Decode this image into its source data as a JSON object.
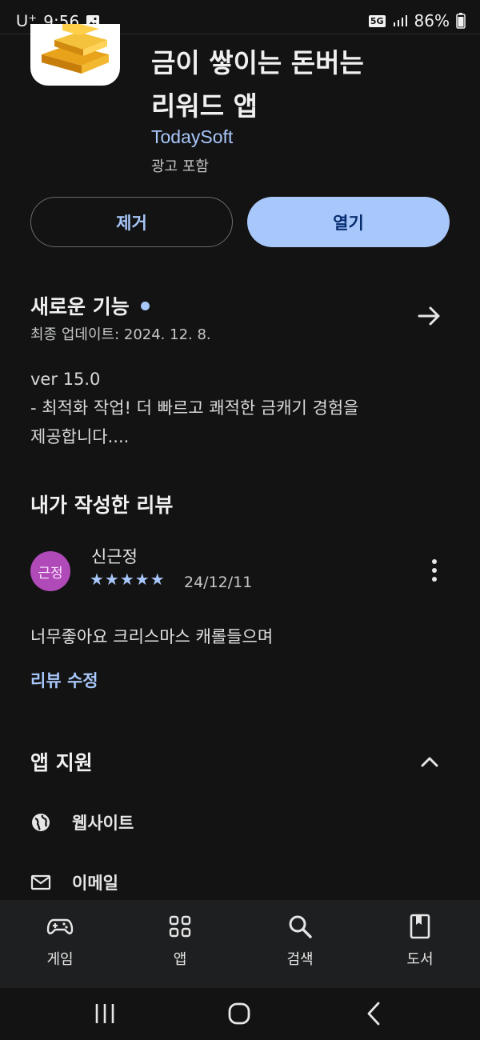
{
  "status_bar": {
    "carrier": "U⁺",
    "time": "9:56",
    "network": "5G",
    "battery": "86%"
  },
  "app": {
    "title_line1": "금이 쌓이는 돈버는",
    "title_line2": "리워드 앱",
    "developer": "TodaySoft",
    "ad_note": "광고 포함"
  },
  "actions": {
    "uninstall_label": "제거",
    "open_label": "열기"
  },
  "whats_new": {
    "title": "새로운 기능",
    "updated": "최종 업데이트: 2024. 12. 8.",
    "notes": [
      "ver 15.0",
      "- 최적화 작업! 더 빠르고 쾌적한 금캐기 경험을",
      "제공합니다...."
    ]
  },
  "my_review": {
    "title": "내가 작성한 리뷰",
    "avatar_text": "근정",
    "reviewer": "신근정",
    "stars": "★★★★★",
    "rating": 5,
    "date": "24/12/11",
    "text": "너무좋아요 크리스마스 캐롤들으며",
    "edit_label": "리뷰 수정"
  },
  "app_support": {
    "title": "앱 지원",
    "website_label": "웹사이트",
    "email_label": "이메일"
  },
  "bottom_nav": {
    "items": [
      {
        "label": "게임",
        "icon": "gamepad-icon"
      },
      {
        "label": "앱",
        "icon": "apps-grid-icon"
      },
      {
        "label": "검색",
        "icon": "search-icon"
      },
      {
        "label": "도서",
        "icon": "book-icon"
      }
    ]
  },
  "colors": {
    "background": "#131313",
    "accent": "#a8c7fa",
    "avatar": "#b04ab8"
  }
}
